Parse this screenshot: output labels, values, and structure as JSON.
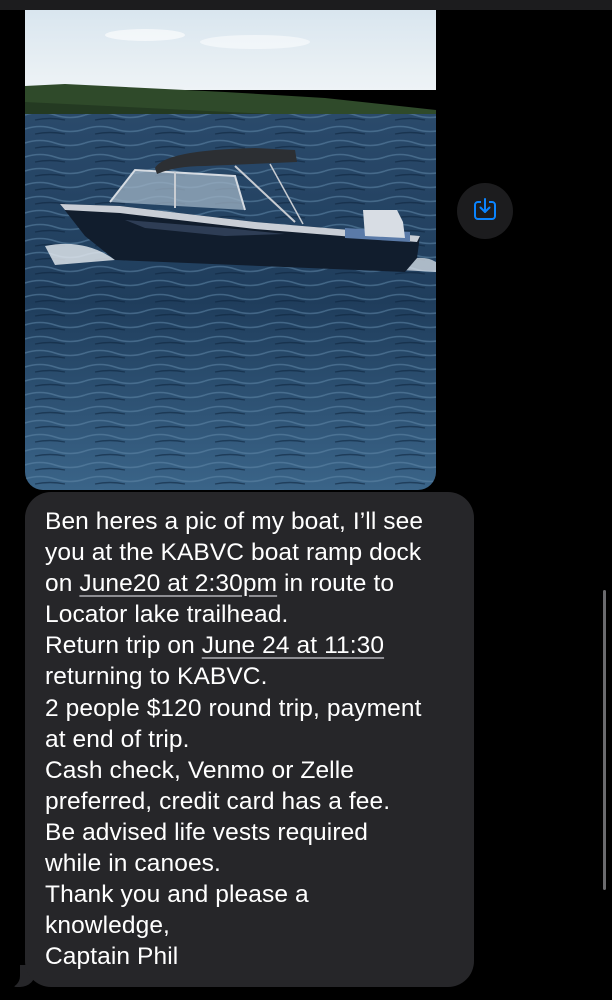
{
  "attachment": {
    "icon": "boat-photo",
    "save_icon": "save-to-device-icon",
    "accent_color": "#0a84ff"
  },
  "message": {
    "line1": "Ben heres a pic of my boat, I’ll see",
    "line2": "you at the KABVC boat ramp dock",
    "line3_pre": "on ",
    "line3_link": "June20 at 2:30pm",
    "line3_post": " in route to",
    "line4": "Locator lake trailhead.",
    "line5_pre": "Return trip on ",
    "line5_link": "June 24 at 11:30",
    "line6": "returning to KABVC.",
    "line7": "2 people $120 round trip, payment",
    "line8": "at end of trip.",
    "line9": "Cash check, Venmo or Zelle",
    "line10": "preferred, credit card has a fee.",
    "line11": "Be advised life vests required",
    "line12": "while in canoes.",
    "line13": "Thank you and please a",
    "line14": "knowledge,",
    "line15": "Captain Phil",
    "bubble_color": "#262629",
    "text_color": "#ffffff"
  }
}
